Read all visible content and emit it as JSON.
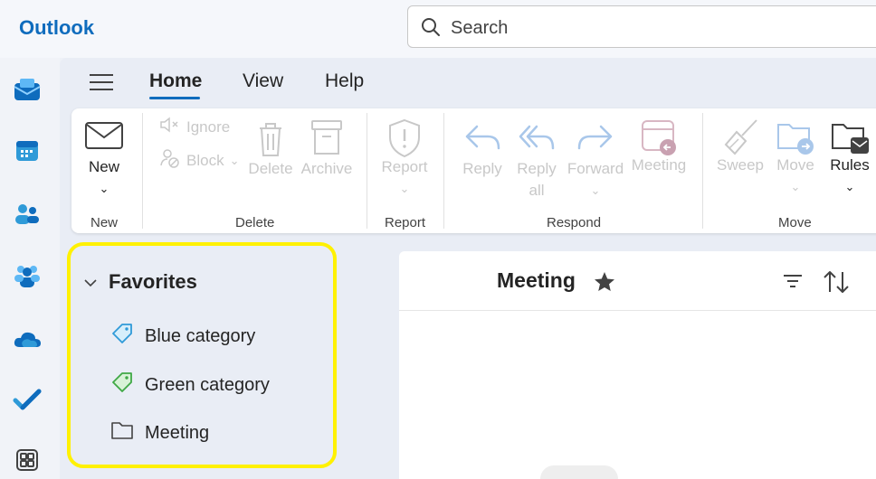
{
  "app": {
    "title": "Outlook"
  },
  "search": {
    "placeholder": "Search"
  },
  "menu": {
    "tabs": [
      "Home",
      "View",
      "Help"
    ]
  },
  "ribbon": {
    "new": {
      "label": "New",
      "group": "New"
    },
    "delete_group": {
      "group": "Delete",
      "ignore": "Ignore",
      "block": "Block",
      "delete": "Delete",
      "archive": "Archive"
    },
    "report_group": {
      "group": "Report",
      "report": "Report"
    },
    "respond_group": {
      "group": "Respond",
      "reply": "Reply",
      "reply_all_line1": "Reply",
      "reply_all_line2": "all",
      "forward": "Forward",
      "meeting": "Meeting"
    },
    "move_group": {
      "group": "Move",
      "sweep": "Sweep",
      "move": "Move",
      "rules": "Rules"
    }
  },
  "favorites": {
    "title": "Favorites",
    "items": [
      {
        "label": "Blue category",
        "icon": "tag-icon",
        "color": "#2f9ad8"
      },
      {
        "label": "Green category",
        "icon": "tag-icon",
        "color": "#3fa845"
      },
      {
        "label": "Meeting",
        "icon": "folder-icon",
        "color": "#424242"
      }
    ]
  },
  "list": {
    "title": "Meeting"
  },
  "colors": {
    "accent": "#0f6cbd",
    "highlight": "#fff100"
  }
}
